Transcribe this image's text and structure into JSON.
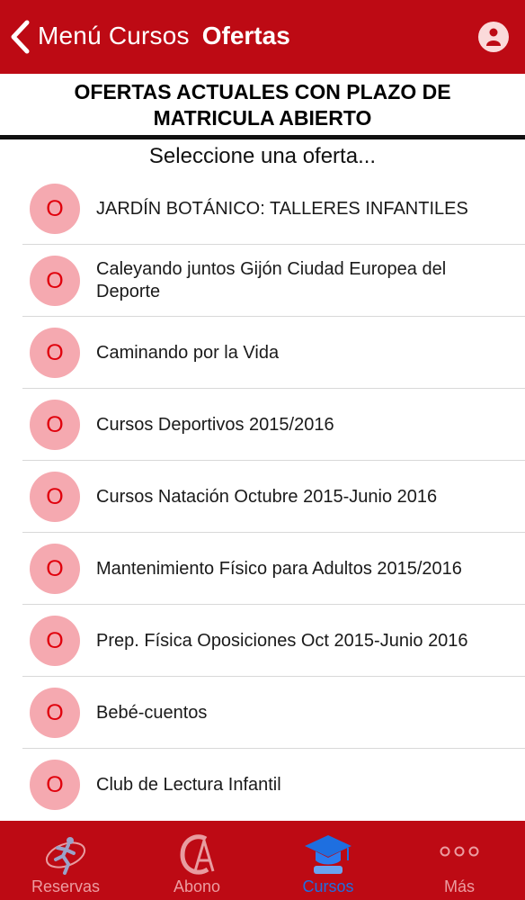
{
  "navbar": {
    "back_label": "Menú Cursos",
    "title": "Ofertas",
    "user_icon": "user-icon"
  },
  "header": {
    "title": "OFERTAS ACTUALES CON PLAZO DE MATRICULA ABIERTO"
  },
  "subtitle": "Seleccione una oferta...",
  "offers": [
    {
      "badge": "O",
      "label": "JARDÍN BOTÁNICO: TALLERES INFANTILES"
    },
    {
      "badge": "O",
      "label": "Caleyando juntos Gijón Ciudad Europea del Deporte"
    },
    {
      "badge": "O",
      "label": "Caminando por la Vida"
    },
    {
      "badge": "O",
      "label": "Cursos Deportivos 2015/2016"
    },
    {
      "badge": "O",
      "label": "Cursos Natación Octubre 2015-Junio 2016"
    },
    {
      "badge": "O",
      "label": "Mantenimiento Físico para Adultos 2015/2016"
    },
    {
      "badge": "O",
      "label": "Prep. Física Oposiciones Oct 2015-Junio 2016"
    },
    {
      "badge": "O",
      "label": "Bebé-cuentos"
    },
    {
      "badge": "O",
      "label": "Club de Lectura Infantil"
    }
  ],
  "tabbar": {
    "tabs": [
      {
        "label": "Reservas",
        "icon": "runner-icon",
        "active": false
      },
      {
        "label": "Abono",
        "icon": "monogram-logo-icon",
        "active": false
      },
      {
        "label": "Cursos",
        "icon": "graduation-cap-icon",
        "active": true
      },
      {
        "label": "Más",
        "icon": "more-dots-icon",
        "active": false
      }
    ]
  },
  "colors": {
    "brand_red": "#bd0a14",
    "badge_bg": "#f5a9b0",
    "badge_text": "#e0000c",
    "active_tab": "#1e6fe0",
    "inactive_tab": "#ec9ca0"
  }
}
